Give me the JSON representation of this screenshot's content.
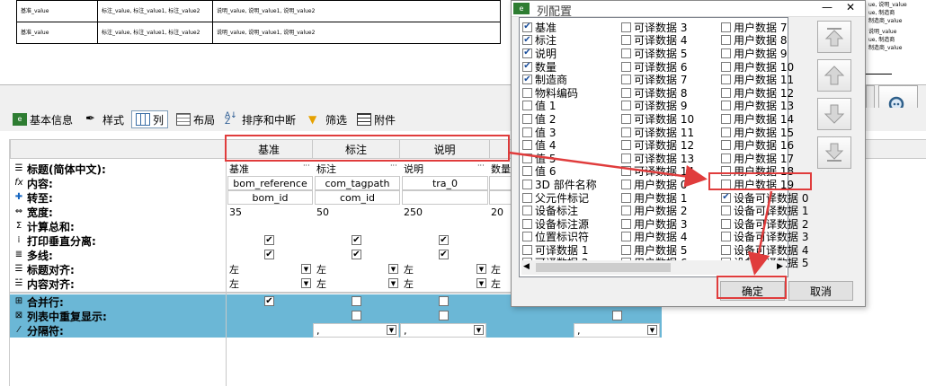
{
  "preview": {
    "rows": [
      {
        "base": "基准_value",
        "tag": "标注_value, 标注_value1, 标注_value2",
        "desc": "说明_value, 说明_value1, 说明_value2"
      },
      {
        "base": "基准_value",
        "tag": "标注_value, 标注_value1, 标注_value2",
        "desc": "说明_value, 说明_value1, 说明_value2"
      }
    ],
    "right_text": [
      "ue, 说明_value",
      "ue, 制造商",
      "制造商_value",
      "说明_value",
      "ue, 制造商",
      "制造商_value"
    ]
  },
  "tabs": [
    {
      "label": "基本信息",
      "icon": "basic-info-icon"
    },
    {
      "label": "样式",
      "icon": "style-icon"
    },
    {
      "label": "列",
      "icon": "columns-icon"
    },
    {
      "label": "布局",
      "icon": "layout-icon"
    },
    {
      "label": "排序和中断",
      "icon": "sort-icon"
    },
    {
      "label": "筛选",
      "icon": "filter-icon"
    },
    {
      "label": "附件",
      "icon": "attachment-icon"
    }
  ],
  "grid": {
    "columns": [
      "基准",
      "标注",
      "说明"
    ],
    "rows": [
      {
        "label": "标题(简体中文):",
        "icon": "title-icon"
      },
      {
        "label": "内容:",
        "icon": "content-fx-icon"
      },
      {
        "label": "转至:",
        "icon": "goto-icon"
      },
      {
        "label": "宽度:",
        "icon": "width-icon"
      },
      {
        "label": "计算总和:",
        "icon": "sum-icon"
      },
      {
        "label": "打印垂直分离:",
        "icon": "print-separator-icon"
      },
      {
        "label": "多线:",
        "icon": "multiline-icon"
      },
      {
        "label": "标题对齐:",
        "icon": "title-align-icon"
      },
      {
        "label": "内容对齐:",
        "icon": "content-align-icon"
      },
      {
        "label": "合并行:",
        "icon": "merge-rows-icon"
      },
      {
        "label": "列表中重复显示:",
        "icon": "repeat-display-icon"
      },
      {
        "label": "分隔符:",
        "icon": "separator-icon"
      }
    ],
    "title_values": [
      "基准",
      "标注",
      "说明",
      "数量"
    ],
    "content_values": [
      "bom_reference",
      "com_tagpath",
      "tra_0"
    ],
    "goto_values": [
      "bom_id",
      "com_id"
    ],
    "width_values": [
      "35",
      "50",
      "250",
      "20"
    ],
    "align_values": [
      "左",
      "左",
      "左",
      "左"
    ],
    "content_align_values": [
      "左",
      "左",
      "左",
      "左"
    ],
    "separator_values": [
      ",",
      ",",
      ","
    ]
  },
  "dialog": {
    "title": "列配置",
    "columns": [
      [
        {
          "label": "基准",
          "checked": true
        },
        {
          "label": "标注",
          "checked": true
        },
        {
          "label": "说明",
          "checked": true
        },
        {
          "label": "数量",
          "checked": true
        },
        {
          "label": "制造商",
          "checked": true
        },
        {
          "label": "物料编码",
          "checked": false
        },
        {
          "label": "值 1",
          "checked": false
        },
        {
          "label": "值 2",
          "checked": false
        },
        {
          "label": "值 3",
          "checked": false
        },
        {
          "label": "值 4",
          "checked": false
        },
        {
          "label": "值 5",
          "checked": false
        },
        {
          "label": "值 6",
          "checked": false
        },
        {
          "label": "3D 部件名称",
          "checked": false
        },
        {
          "label": "父元件标记",
          "checked": false
        },
        {
          "label": "设备标注",
          "checked": false
        },
        {
          "label": "设备标注源",
          "checked": false
        },
        {
          "label": "位置标识符",
          "checked": false
        },
        {
          "label": "可译数据 1",
          "checked": false
        },
        {
          "label": "可译数据 2",
          "checked": false
        }
      ],
      [
        {
          "label": "可译数据 3",
          "checked": false
        },
        {
          "label": "可译数据 4",
          "checked": false
        },
        {
          "label": "可译数据 5",
          "checked": false
        },
        {
          "label": "可译数据 6",
          "checked": false
        },
        {
          "label": "可译数据 7",
          "checked": false
        },
        {
          "label": "可译数据 8",
          "checked": false
        },
        {
          "label": "可译数据 9",
          "checked": false
        },
        {
          "label": "可译数据 10",
          "checked": false
        },
        {
          "label": "可译数据 11",
          "checked": false
        },
        {
          "label": "可译数据 12",
          "checked": false
        },
        {
          "label": "可译数据 13",
          "checked": false
        },
        {
          "label": "可译数据 14",
          "checked": false
        },
        {
          "label": "用户数据 0",
          "checked": false
        },
        {
          "label": "用户数据 1",
          "checked": false
        },
        {
          "label": "用户数据 2",
          "checked": false
        },
        {
          "label": "用户数据 3",
          "checked": false
        },
        {
          "label": "用户数据 4",
          "checked": false
        },
        {
          "label": "用户数据 5",
          "checked": false
        },
        {
          "label": "用户数据 6",
          "checked": false
        }
      ],
      [
        {
          "label": "用户数据 7",
          "checked": false
        },
        {
          "label": "用户数据 8",
          "checked": false
        },
        {
          "label": "用户数据 9",
          "checked": false
        },
        {
          "label": "用户数据 10",
          "checked": false
        },
        {
          "label": "用户数据 11",
          "checked": false
        },
        {
          "label": "用户数据 12",
          "checked": false
        },
        {
          "label": "用户数据 13",
          "checked": false
        },
        {
          "label": "用户数据 14",
          "checked": false
        },
        {
          "label": "用户数据 15",
          "checked": false
        },
        {
          "label": "用户数据 16",
          "checked": false
        },
        {
          "label": "用户数据 17",
          "checked": false
        },
        {
          "label": "用户数据 18",
          "checked": false
        },
        {
          "label": "用户数据 19",
          "checked": false
        },
        {
          "label": "设备可译数据 0",
          "checked": true
        },
        {
          "label": "设备可译数据 1",
          "checked": false
        },
        {
          "label": "设备可译数据 2",
          "checked": false
        },
        {
          "label": "设备可译数据 3",
          "checked": false
        },
        {
          "label": "设备可译数据 4",
          "checked": false
        },
        {
          "label": "设备可译数据 5",
          "checked": false
        }
      ]
    ],
    "ok_label": "确定",
    "cancel_label": "取消",
    "move_buttons": [
      "move-top-icon",
      "move-up-icon",
      "move-down-icon",
      "move-bottom-icon"
    ]
  },
  "colors": {
    "selected_row": "#6bb7d6",
    "highlight_box": "#e03c3c",
    "dialog_bg": "#f0f0f0"
  }
}
